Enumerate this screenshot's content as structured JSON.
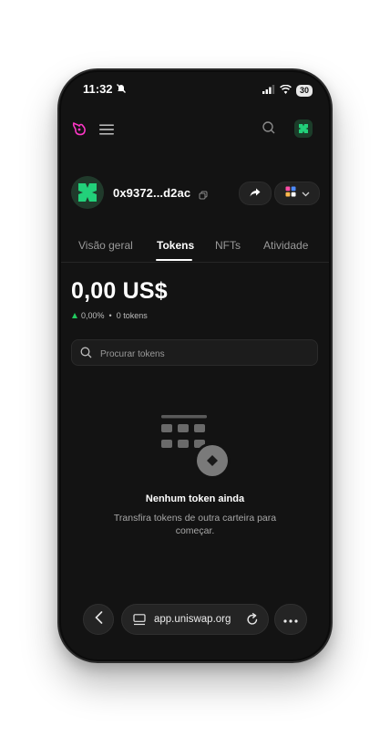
{
  "status_bar": {
    "time": "11:32",
    "battery": "30"
  },
  "account": {
    "address": "0x9372...d2ac"
  },
  "tabs": [
    {
      "label": "Visão geral"
    },
    {
      "label": "Tokens"
    },
    {
      "label": "NFTs"
    },
    {
      "label": "Atividade"
    }
  ],
  "active_tab": "Tokens",
  "balance": {
    "amount": "0,00 US$",
    "change_percent": "0,00%",
    "separator": "•",
    "token_count": "0 tokens"
  },
  "search": {
    "placeholder": "Procurar tokens"
  },
  "empty_state": {
    "title": "Nenhum token ainda",
    "description": "Transfira tokens de outra carteira para começar."
  },
  "browser": {
    "url": "app.uniswap.org"
  },
  "colors": {
    "background": "#131313",
    "accent_pink": "#ff37c7",
    "avatar_green": "#22d17a",
    "positive_green": "#21c95e"
  },
  "icons": [
    "uniswap-logo",
    "menu-icon",
    "search-icon",
    "copy-icon",
    "share-arrow-icon",
    "apps-grid-icon",
    "chevron-down-icon",
    "back-arrow-icon",
    "site-icon",
    "reload-icon",
    "more-icon"
  ]
}
